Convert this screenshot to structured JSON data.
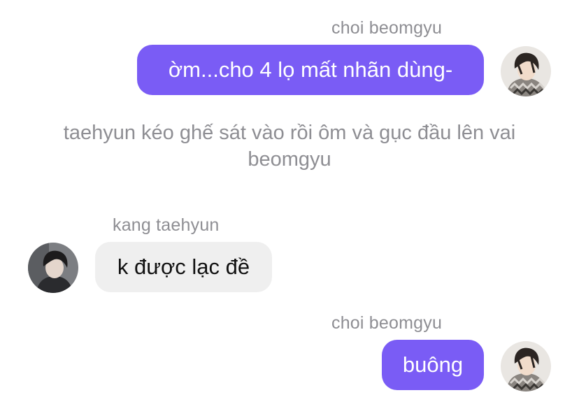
{
  "messages": [
    {
      "sender": "choi beomgyu",
      "text": "ờm...cho 4 lọ mất nhãn dùng-",
      "avatar": "avatar-beomgyu"
    },
    {
      "narration": "taehyun kéo ghế sát vào rồi ôm và gục đầu lên vai beomgyu"
    },
    {
      "sender": "kang taehyun",
      "text": "k được lạc đề",
      "avatar": "avatar-taehyun"
    },
    {
      "sender": "choi beomgyu",
      "text": "buông",
      "avatar": "avatar-beomgyu"
    }
  ],
  "colors": {
    "outgoing_bubble": "#7a5cf5",
    "incoming_bubble": "#efefef",
    "name_text": "#8e8e93"
  }
}
